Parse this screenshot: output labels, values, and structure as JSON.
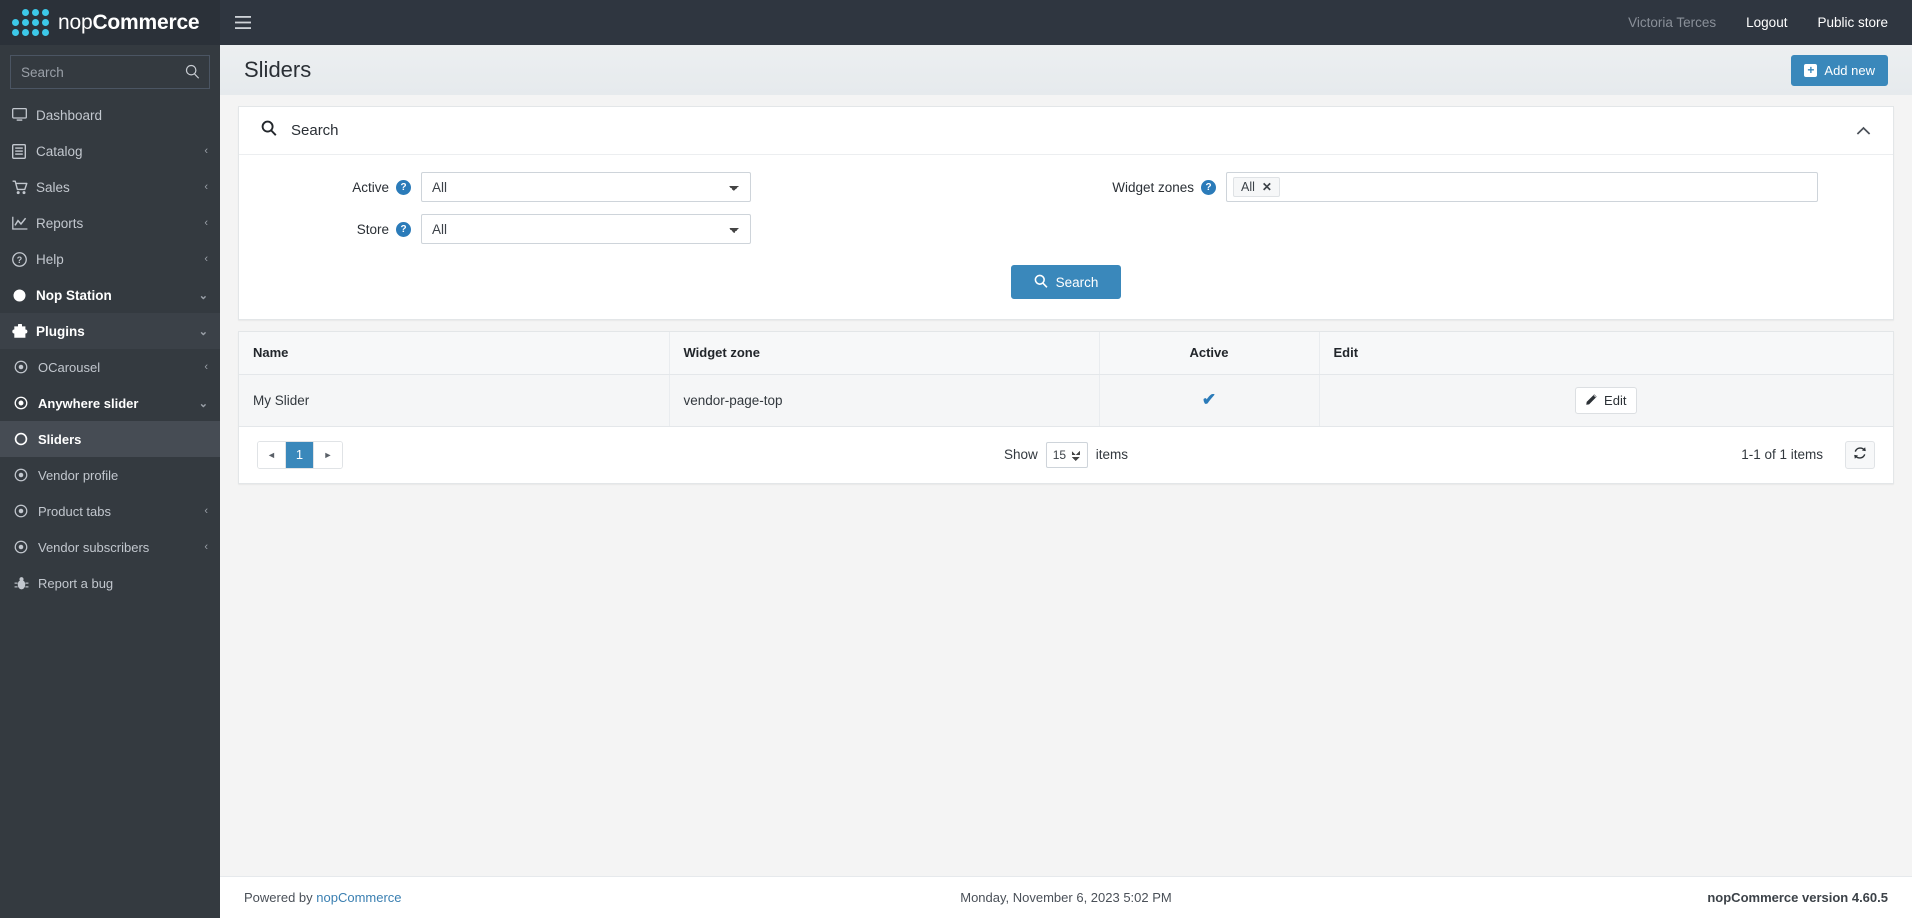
{
  "topbar": {
    "brand_nop": "nop",
    "brand_commerce": "Commerce",
    "menu_icon": "hamburger-icon",
    "user": "Victoria Terces",
    "logout": "Logout",
    "public_store": "Public store"
  },
  "sidebar": {
    "search_placeholder": "Search",
    "search_icon": "search-icon",
    "items": [
      {
        "label": "Dashboard",
        "icon": "desktop-icon",
        "caret": "",
        "level": "top"
      },
      {
        "label": "Catalog",
        "icon": "book-icon",
        "caret": "‹",
        "level": "top"
      },
      {
        "label": "Sales",
        "icon": "cart-icon",
        "caret": "‹",
        "level": "top"
      },
      {
        "label": "Reports",
        "icon": "chart-icon",
        "caret": "‹",
        "level": "top"
      },
      {
        "label": "Help",
        "icon": "question-icon",
        "caret": "‹",
        "level": "top"
      },
      {
        "label": "Nop Station",
        "icon": "circle-icon",
        "caret": "⌄",
        "level": "top"
      },
      {
        "label": "Plugins",
        "icon": "puzzle-icon",
        "caret": "⌄",
        "level": "top"
      },
      {
        "label": "OCarousel",
        "icon": "dot-circle-icon",
        "caret": "‹",
        "level": "child"
      },
      {
        "label": "Anywhere slider",
        "icon": "dot-circle-icon",
        "caret": "⌄",
        "level": "child"
      },
      {
        "label": "Sliders",
        "icon": "circle-o-icon",
        "caret": "",
        "level": "child"
      },
      {
        "label": "Vendor profile",
        "icon": "dot-circle-icon",
        "caret": "",
        "level": "child"
      },
      {
        "label": "Product tabs",
        "icon": "dot-circle-icon",
        "caret": "‹",
        "level": "child"
      },
      {
        "label": "Vendor subscribers",
        "icon": "dot-circle-icon",
        "caret": "‹",
        "level": "child"
      },
      {
        "label": "Report a bug",
        "icon": "bug-icon",
        "caret": "",
        "level": "child"
      }
    ]
  },
  "page": {
    "title": "Sliders",
    "add_new": "Add new",
    "add_new_icon": "plus-square-icon"
  },
  "search_panel": {
    "title": "Search",
    "title_icon": "search-icon",
    "collapse_icon": "chevron-up-icon",
    "active_label": "Active",
    "active_value": "All",
    "store_label": "Store",
    "store_value": "All",
    "widget_zones_label": "Widget zones",
    "widget_zones_tag": "All",
    "widget_zones_remove_icon": "close-icon",
    "help_icon": "?",
    "search_button": "Search",
    "search_button_icon": "search-icon"
  },
  "table": {
    "columns": [
      "Name",
      "Widget zone",
      "Active",
      "Edit"
    ],
    "rows": [
      {
        "name": "My Slider",
        "widget_zone": "vendor-page-top",
        "active": "✔",
        "edit_label": "Edit",
        "edit_icon": "pencil-icon"
      }
    ]
  },
  "pagination": {
    "prev_icon": "◄",
    "page": "1",
    "next_icon": "►",
    "show_label": "Show",
    "page_size": "15",
    "items_label": "items",
    "count": "1-1 of 1 items",
    "refresh_icon": "refresh-icon"
  },
  "footer": {
    "powered_by": "Powered by",
    "powered_link": "nopCommerce",
    "timestamp": "Monday, November 6, 2023 5:02 PM",
    "version": "nopCommerce version 4.60.5"
  }
}
